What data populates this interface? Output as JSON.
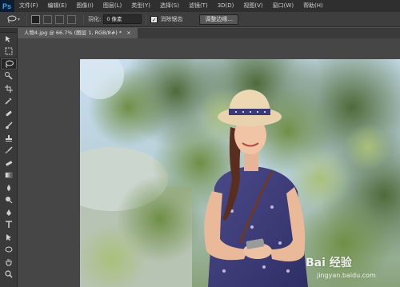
{
  "app": {
    "logo": "Ps"
  },
  "menu": [
    "文件(F)",
    "编辑(E)",
    "图像(I)",
    "图层(L)",
    "类型(Y)",
    "选择(S)",
    "滤镜(T)",
    "3D(D)",
    "视图(V)",
    "窗口(W)",
    "帮助(H)"
  ],
  "options": {
    "tool_icon": "lasso-icon",
    "feather_label": "羽化:",
    "feather_value": "0 像素",
    "antialias_label": "消除锯齿",
    "antialias_checked": true,
    "refine_edge_button": "调整边缘..."
  },
  "document": {
    "tab_title": "人物4.jpg @ 66.7% (图层 1, RGB/8#) *",
    "close_glyph": "×"
  },
  "tools": [
    "move-icon",
    "marquee-icon",
    "lasso-icon",
    "quick-select-icon",
    "crop-icon",
    "eyedropper-icon",
    "healing-icon",
    "brush-icon",
    "stamp-icon",
    "history-brush-icon",
    "eraser-icon",
    "gradient-icon",
    "blur-icon",
    "dodge-icon",
    "pen-icon",
    "type-icon",
    "path-select-icon",
    "shape-icon",
    "hand-icon",
    "zoom-icon"
  ],
  "active_tool": "lasso-icon",
  "watermark": {
    "brand": "Bai 经验",
    "url": "jingyan.baidu.com"
  }
}
